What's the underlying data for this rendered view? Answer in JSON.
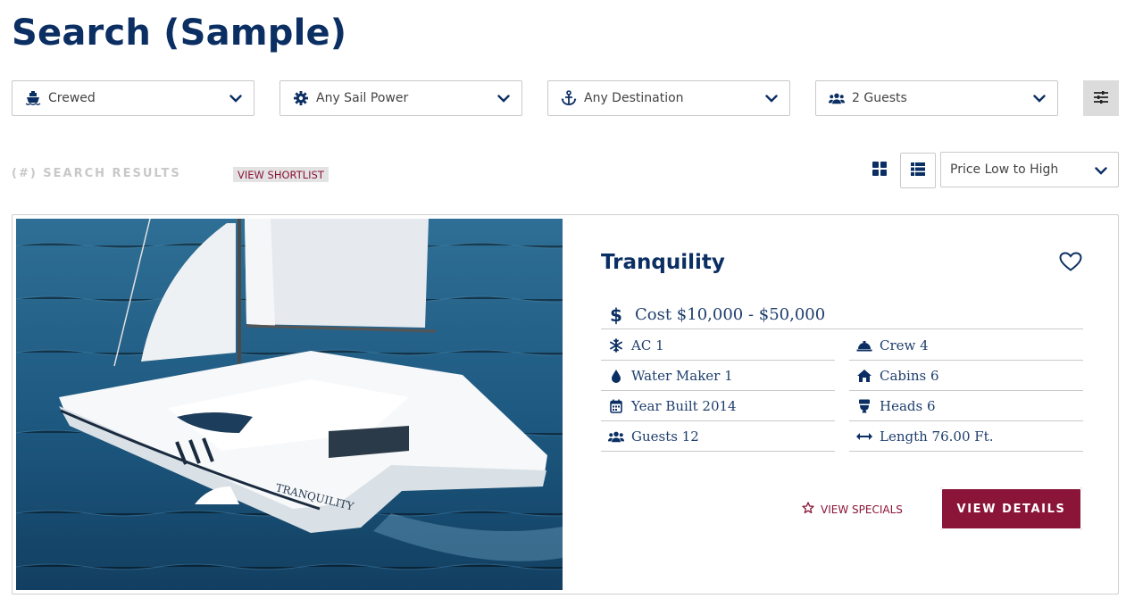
{
  "page": {
    "title": "Search (Sample)"
  },
  "filters": [
    {
      "label": "Crewed",
      "icon": "ship-icon"
    },
    {
      "label": "Any Sail Power",
      "icon": "gear-icon"
    },
    {
      "label": "Any Destination",
      "icon": "anchor-icon"
    },
    {
      "label": "2 Guests",
      "icon": "users-icon"
    }
  ],
  "results": {
    "count_label": "(#) SEARCH RESULTS",
    "shortlist_label": "VIEW SHORTLIST",
    "sort": {
      "selected": "Price Low to High"
    }
  },
  "listing": {
    "name": "Tranquility",
    "cost": "Cost $10,000 - $50,000",
    "specs_left": [
      {
        "label": "AC 1",
        "icon": "snowflake-icon"
      },
      {
        "label": "Water Maker 1",
        "icon": "water-drop-icon"
      },
      {
        "label": "Year Built 2014",
        "icon": "calendar-icon"
      },
      {
        "label": "Guests 12",
        "icon": "users-icon"
      }
    ],
    "specs_right": [
      {
        "label": "Crew 4",
        "icon": "service-bell-icon"
      },
      {
        "label": "Cabins 6",
        "icon": "home-icon"
      },
      {
        "label": "Heads 6",
        "icon": "toilet-icon"
      },
      {
        "label": "Length 76.00 Ft.",
        "icon": "arrows-horizontal-icon"
      }
    ],
    "specials_label": "VIEW SPECIALS",
    "details_label": "VIEW DETAILS"
  },
  "colors": {
    "navy": "#0b2f63",
    "burgundy": "#8a1538",
    "border": "#c9c9c9",
    "muted": "#c8c8c8"
  }
}
